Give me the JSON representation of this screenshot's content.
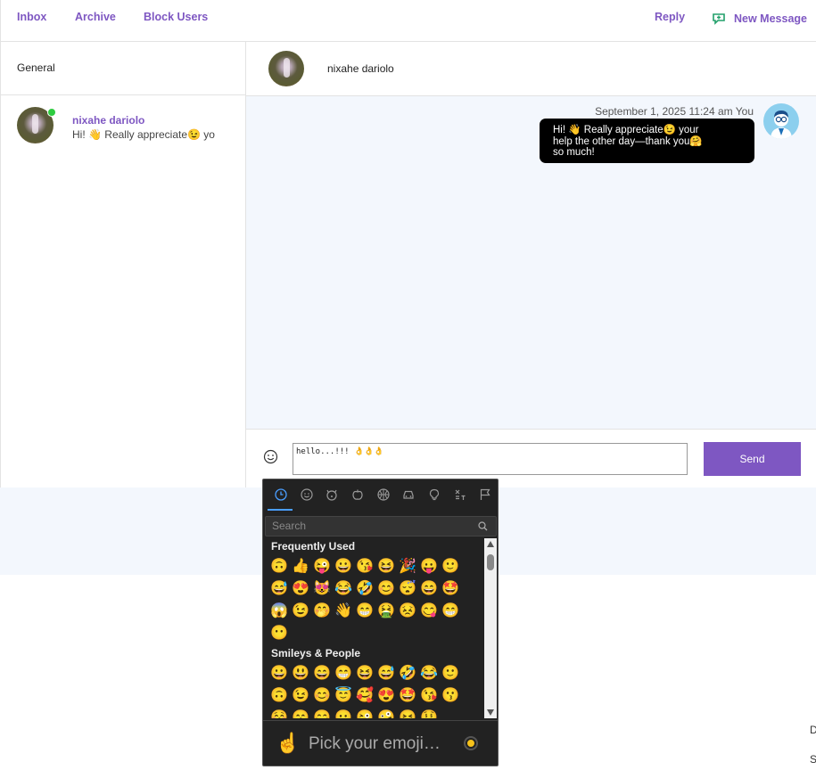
{
  "nav": {
    "inbox": "Inbox",
    "archive": "Archive",
    "block_users": "Block Users",
    "reply": "Reply",
    "new_message": "New Message"
  },
  "sidebar": {
    "section_label": "General",
    "conversation": {
      "name": "nixahe dariolo",
      "preview": "Hi! 👋 Really appreciate😉 yo",
      "online": true
    }
  },
  "chat": {
    "header_name": "nixahe dariolo",
    "messages": [
      {
        "meta": "September 1, 2025 11:24 am You",
        "lines": [
          "Hi! 👋 Really appreciate😉 your",
          "help the other day—thank you🤗",
          "so much!"
        ]
      }
    ]
  },
  "composer": {
    "input_value": "hello...!!! 👌👌👌",
    "send_label": "Send"
  },
  "emoji_picker": {
    "search_placeholder": "Search",
    "sections": [
      {
        "title": "Frequently Used",
        "emojis": [
          "🙃",
          "👍",
          "😜",
          "😀",
          "😘",
          "😆",
          "🎉",
          "😛",
          "🙂",
          "😅",
          "😍",
          "😻",
          "😂",
          "🤣",
          "😊",
          "😴",
          "😄",
          "🤩",
          "😱",
          "😉",
          "🤭",
          "👋",
          "😁",
          "🤮",
          "😣",
          "😋",
          "😁",
          "😶"
        ]
      },
      {
        "title": "Smileys & People",
        "emojis": [
          "😀",
          "😃",
          "😄",
          "😁",
          "😆",
          "😅",
          "🤣",
          "😂",
          "🙂",
          "🙃",
          "😉",
          "😊",
          "😇",
          "🥰",
          "😍",
          "🤩",
          "😘",
          "😗",
          "😚",
          "😙",
          "😋",
          "😛",
          "😜",
          "🤪",
          "😝",
          "🤑"
        ]
      }
    ],
    "preview_emoji": "☝️",
    "preview_text": "Pick your emoji…",
    "skin_tone_color": "#f6c21b"
  },
  "edge_text": [
    "D",
    "S"
  ],
  "colors": {
    "accent": "#7e57c2",
    "online": "#2ecc40",
    "chat_bg": "#f3f7fd"
  }
}
